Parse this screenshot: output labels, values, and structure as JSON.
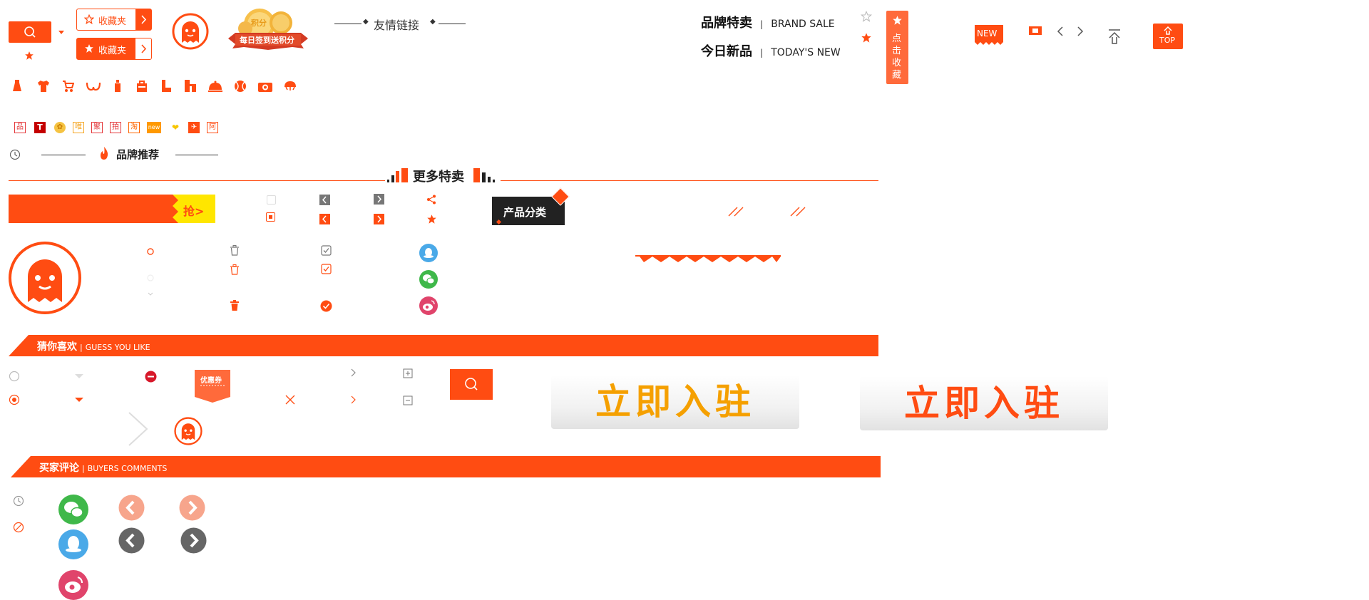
{
  "topbar": {
    "collect_label_outline": "收藏夹",
    "collect_label_solid": "收藏夹",
    "signin_banner": "每日签到送积分",
    "signin_coin_text": "积分",
    "friend_links": "友情链接",
    "brand_sale_cn": "品牌特卖",
    "brand_sale_en": "BRAND SALE",
    "todays_new_cn": "今日新品",
    "todays_new_en": "TODAY'S NEW",
    "fav_vertical": [
      "点",
      "击",
      "收",
      "藏"
    ],
    "new_badge": "NEW",
    "top_button": "TOP"
  },
  "category_icons": [
    "dress-icon",
    "tshirt-icon",
    "stroller-icon",
    "bra-icon",
    "bottle-icon",
    "bag-icon",
    "boot-icon",
    "pants-icon",
    "dish-icon",
    "ball-icon",
    "camera-icon",
    "lamp-icon"
  ],
  "brand_icons": [
    {
      "char": "品",
      "color": "#e4393c"
    },
    {
      "char": "T",
      "color": "#c40000"
    },
    {
      "char": "✿",
      "color": "#f5a623"
    },
    {
      "char": "唯",
      "color": "#f5a623"
    },
    {
      "char": "聚",
      "color": "#e4393c"
    },
    {
      "char": "拍",
      "color": "#e4393c"
    },
    {
      "char": "淘",
      "color": "#ff6600"
    },
    {
      "char": "new",
      "color": "#ff9900"
    },
    {
      "char": "❤",
      "color": "#f7c600"
    },
    {
      "char": "✈",
      "color": "#ff4c12"
    },
    {
      "char": "阿",
      "color": "#ff4c12"
    }
  ],
  "brand_recommend": "品牌推荐",
  "more_sale": "更多特卖",
  "grab_label": "抢>",
  "product_category": "产品分类",
  "guess_you_like": {
    "cn": "猜你喜欢",
    "en": "GUESS YOU LIKE"
  },
  "coupon": "优惠券",
  "enter_now": "立即入驻",
  "buyers_comments": {
    "cn": "买家评论",
    "en": "BUYERS COMMENTS"
  },
  "colors": {
    "accent": "#ff4c12",
    "qq": "#4aa9e8",
    "wechat": "#3fb84a",
    "weibo": "#e0446b",
    "dark": "#222222",
    "yellow": "#ffe600"
  }
}
